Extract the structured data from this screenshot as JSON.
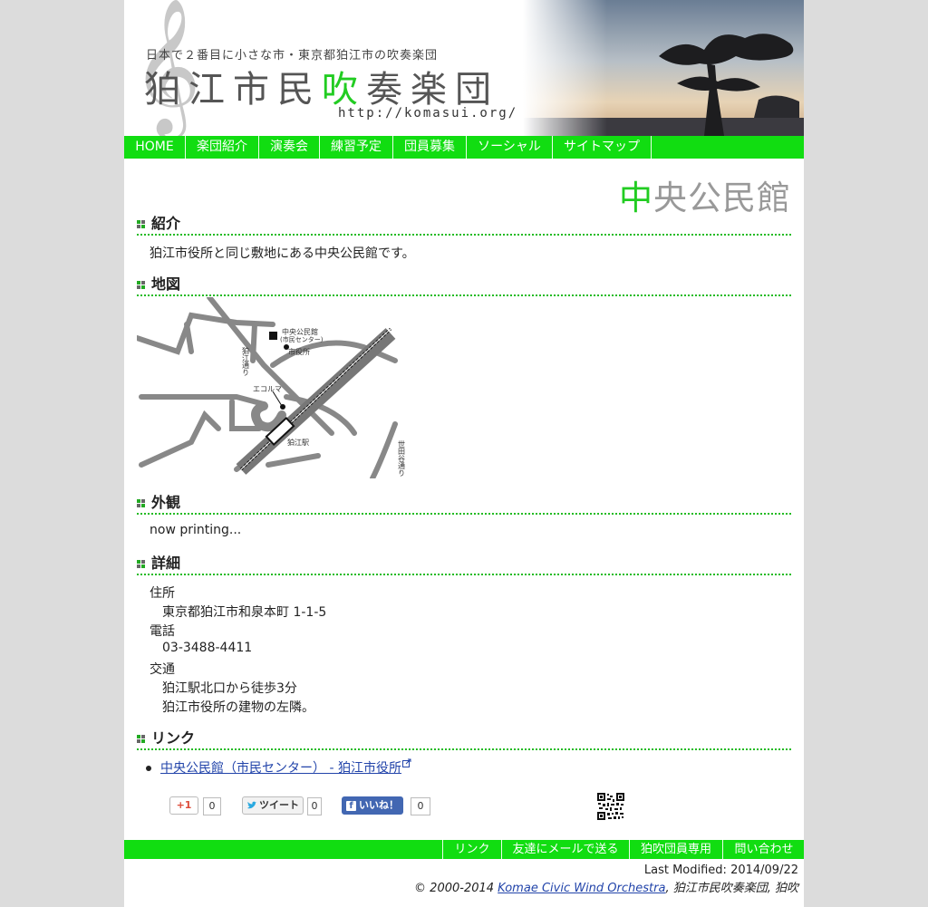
{
  "header": {
    "tagline": "日本で２番目に小さな市・東京都狛江市の吹奏楽団",
    "name_part1": "狛江市民",
    "name_accent": "吹",
    "name_part2": "奏楽団",
    "url": "http://komasui.org/"
  },
  "nav": {
    "items": [
      {
        "label": "HOME"
      },
      {
        "label": "楽団紹介"
      },
      {
        "label": "演奏会"
      },
      {
        "label": "練習予定"
      },
      {
        "label": "団員募集"
      },
      {
        "label": "ソーシャル"
      },
      {
        "label": "サイトマップ"
      }
    ]
  },
  "page": {
    "title_accent": "中",
    "title_rest": "央公民館"
  },
  "sections": {
    "intro": {
      "heading": "紹介",
      "text": "狛江市役所と同じ敷地にある中央公民館です。"
    },
    "map": {
      "heading": "地図",
      "labels": {
        "hall": "中央公民館",
        "center": "(市民センター)",
        "city_hall": "市役所",
        "komae_dori": "狛江通り",
        "ecolma": "エコルマ",
        "station": "狛江駅",
        "setagaya_dori": "世田谷通り"
      }
    },
    "appearance": {
      "heading": "外観",
      "text": "now printing..."
    },
    "details": {
      "heading": "詳細",
      "address_label": "住所",
      "address": "東京都狛江市和泉本町 1-1-5",
      "phone_label": "電話",
      "phone": "03-3488-4411",
      "access_label": "交通",
      "access1": "狛江駅北口から徒歩3分",
      "access2": "狛江市役所の建物の左隣。"
    },
    "links": {
      "heading": "リンク",
      "item": "中央公民館（市民センター） - 狛江市役所"
    }
  },
  "social": {
    "gplus": {
      "label": "+1",
      "count": "0"
    },
    "tweet": {
      "label": "ツイート",
      "count": "0"
    },
    "facebook": {
      "label": "いいね！",
      "count": "0"
    }
  },
  "footer": {
    "nav": [
      {
        "label": "リンク"
      },
      {
        "label": "友達にメールで送る"
      },
      {
        "label": "狛吹団員専用"
      },
      {
        "label": "問い合わせ"
      }
    ],
    "last_modified": "Last Modified: 2014/09/22",
    "copyright_prefix": "© 2000-2014 ",
    "copyright_link": "Komae Civic Wind Orchestra",
    "copyright_suffix": ", 狛江市民吹奏楽団, 狛吹"
  },
  "colors": {
    "accent": "#11dd11",
    "link": "#2244aa"
  }
}
